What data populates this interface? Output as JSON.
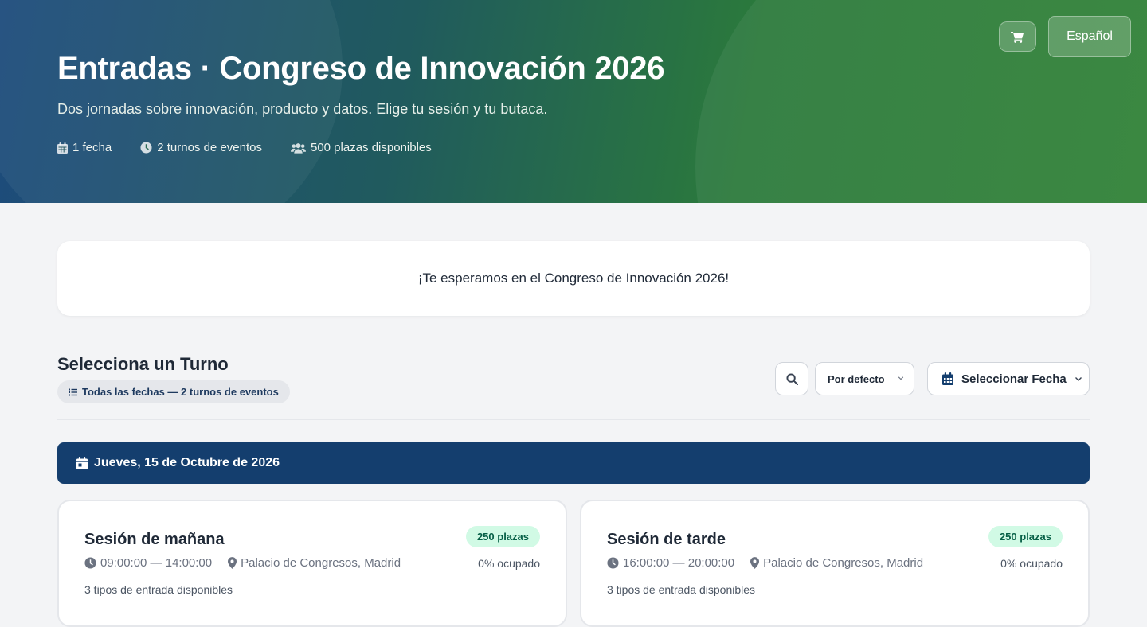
{
  "hero": {
    "title": "Entradas · Congreso de Innovación 2026",
    "subtitle": "Dos jornadas sobre innovación, producto y datos. Elige tu sesión y tu butaca.",
    "stats": [
      {
        "icon": "calendar-icon",
        "label": "1 fecha"
      },
      {
        "icon": "clock-icon",
        "label": "2 turnos de eventos"
      },
      {
        "icon": "users-icon",
        "label": "500 plazas disponibles"
      }
    ],
    "language_label": "Español",
    "cart_icon": "cart-icon",
    "gradient_colors": [
      "#1d4b7c",
      "#2f8136"
    ]
  },
  "welcome_message": "¡Te esperamos en el Congreso de Innovación 2026!",
  "turnos": {
    "title": "Selecciona un Turno",
    "filter_summary": "Todas las fechas — 2 turnos de eventos",
    "sort_label": "Por defecto",
    "date_select_label": "Seleccionar Fecha"
  },
  "date_group": {
    "label": "Jueves, 15 de Octubre de 2026",
    "color": "#143e6e"
  },
  "sessions": [
    {
      "name": "Sesión de mañana",
      "time": "09:00:00 — 14:00:00",
      "venue": "Palacio de Congresos, Madrid",
      "ticket_types": "3 tipos de entrada disponibles",
      "capacity_badge": "250 plazas",
      "occupancy": "0% ocupado"
    },
    {
      "name": "Sesión de tarde",
      "time": "16:00:00 — 20:00:00",
      "venue": "Palacio de Congresos, Madrid",
      "ticket_types": "3 tipos de entrada disponibles",
      "capacity_badge": "250 plazas",
      "occupancy": "0% ocupado"
    }
  ]
}
